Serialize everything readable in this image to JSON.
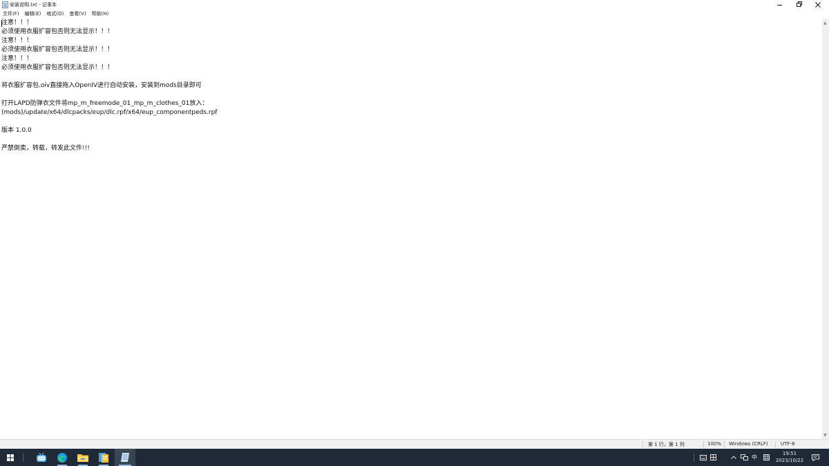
{
  "window": {
    "title": "安装说明.txt - 记事本"
  },
  "menu": {
    "items": [
      {
        "label": "文件(F)"
      },
      {
        "label": "编辑(E)"
      },
      {
        "label": "格式(O)"
      },
      {
        "label": "查看(V)"
      },
      {
        "label": "帮助(H)"
      }
    ]
  },
  "document": {
    "lines": [
      "注意！！！",
      "必须使用衣服扩容包否则无法显示！！！",
      "注意！！！",
      "必须使用衣服扩容包否则无法显示！！！",
      "注意！！！",
      "必须使用衣服扩容包否则无法显示！！！",
      "",
      "将衣服扩容包.oiv直接拖入OpenIV进行自动安装，安装到mods目录即可",
      "",
      "打开LAPD防弹衣文件将mp_m_freemode_01_mp_m_clothes_01放入：",
      "(mods)/update/x64/dlcpacks/eup/dlc.rpf/x64/eup_componentpeds.rpf",
      "",
      "版本 1.0.0",
      "",
      "严禁倒卖，转载，转发此文件!!!"
    ]
  },
  "status": {
    "position": "第 1 行，第 1 列",
    "zoom": "100%",
    "line_ending": "Windows (CRLF)",
    "encoding": "UTF-8"
  },
  "taskbar": {
    "tray": {
      "ime_mode": "中",
      "time": "19:51",
      "date": "2023/10/22"
    }
  }
}
